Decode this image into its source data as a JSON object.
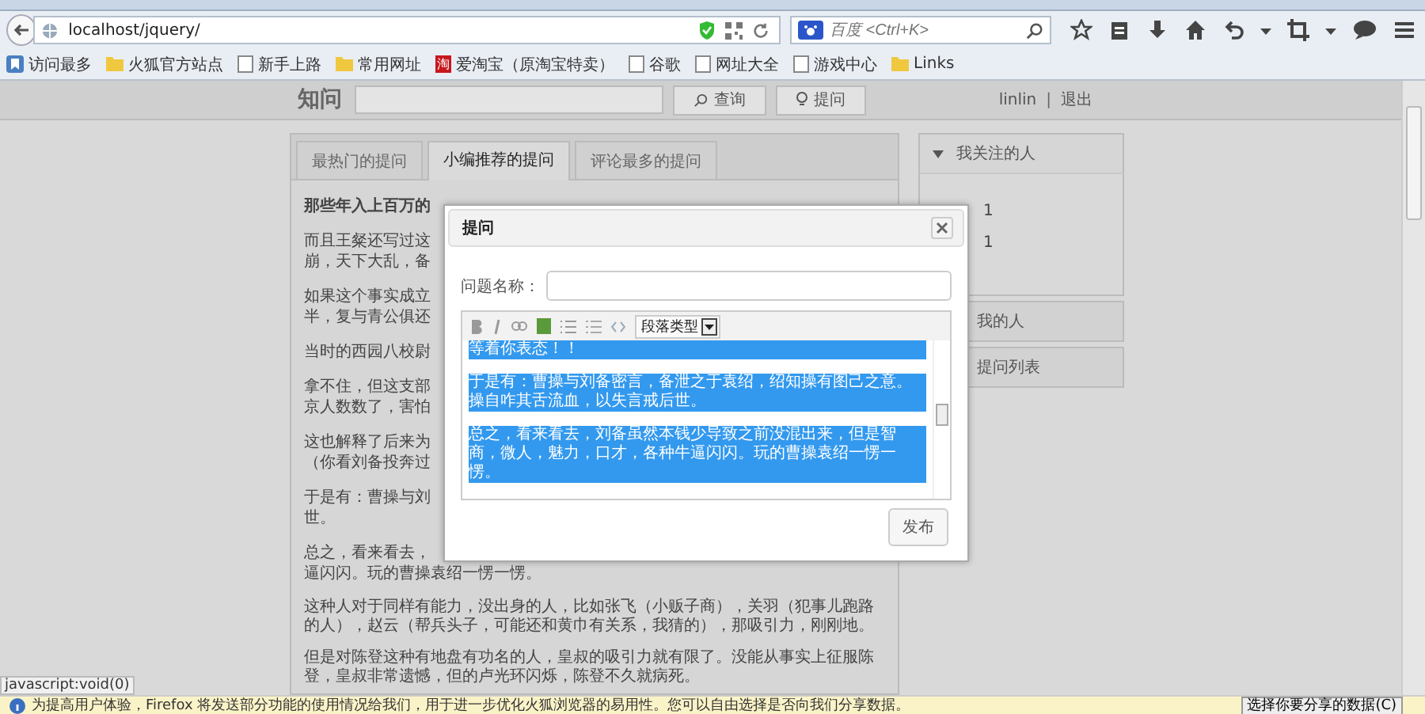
{
  "browser": {
    "address": "localhost/jquery/",
    "search_placeholder": "百度 <Ctrl+K>",
    "bookmarks": [
      {
        "label": "访问最多",
        "kind": "smart"
      },
      {
        "label": "火狐官方站点",
        "kind": "folder"
      },
      {
        "label": "新手上路",
        "kind": "page"
      },
      {
        "label": "常用网址",
        "kind": "folder"
      },
      {
        "label": "爱淘宝（原淘宝特卖）",
        "kind": "taobao",
        "icon_text": "淘"
      },
      {
        "label": "谷歌",
        "kind": "page"
      },
      {
        "label": "网址大全",
        "kind": "page"
      },
      {
        "label": "游戏中心",
        "kind": "page"
      },
      {
        "label": "Links",
        "kind": "folder"
      }
    ]
  },
  "header": {
    "logo": "知问",
    "buttons": [
      {
        "label": "查询",
        "kind": "search"
      },
      {
        "label": "提问",
        "kind": "ask"
      }
    ],
    "user": "linlin",
    "separator": "|",
    "logout": "退出"
  },
  "tabs": [
    {
      "label": "最热门的提问",
      "selected": false
    },
    {
      "label": "小编推荐的提问",
      "selected": true
    },
    {
      "label": "评论最多的提问",
      "selected": false
    }
  ],
  "article": {
    "title": "那些年入上百万的",
    "paragraphs": [
      [
        "而且王粲还写过这",
        "崩，天下大乱，备"
      ],
      [
        "如果这个事实成立",
        "半，复与青公俱还"
      ],
      [
        "当时的西园八校尉"
      ],
      [
        "拿不住，但这支部",
        "京人数数了，害怕"
      ],
      [
        "这也解释了后来为",
        "（你看刘备投奔过"
      ],
      [
        "于是有：曹操与刘",
        "世。"
      ],
      [
        "总之，看来看去，",
        "逼闪闪。玩的曹操袁绍一愣一愣。"
      ],
      [
        "这种人对于同样有能力，没出身的人，比如张飞（小贩子商），关羽（犯事儿跑路的人），赵云（帮兵头子，可能还和黄巾有关系，我猜的），那吸引力，刚刚地。"
      ],
      [
        "但是对陈登这种有地盘有功名的人，皇叔的吸引力就有限了。没能从事实上征服陈登，皇叔非常遗憾，但的卢光环闪烁，陈登不久就病死。"
      ]
    ]
  },
  "sidebar": [
    {
      "title": "我关注的人",
      "expanded": true,
      "items": [
        "1",
        "1"
      ]
    },
    {
      "title": "我的人",
      "expanded": false
    },
    {
      "title": "提问列表",
      "expanded": false
    }
  ],
  "dialog": {
    "title": "提问",
    "name_label": "问题名称：",
    "format_select": "段落类型",
    "editor_paragraphs": [
      "等着你表态！！",
      "于是有：曹操与刘备密言，备泄之于袁绍，绍知操有图己之意。操自咋其舌流血，以失言戒后世。",
      "总之，看来看去，刘备虽然本钱少导致之前没混出来，但是智商，微人，魅力，口才，各种牛逼闪闪。玩的曹操袁绍一愣一愣。"
    ],
    "submit": "发布"
  },
  "status_text": "javascript:void(0)",
  "notification": {
    "message": "为提高用户体验，Firefox 将发送部分功能的使用情况给我们，用于进一步优化火狐浏览器的易用性。您可以自由选择是否向我们分享数据。",
    "button": "选择你要分享的数据(C)"
  }
}
